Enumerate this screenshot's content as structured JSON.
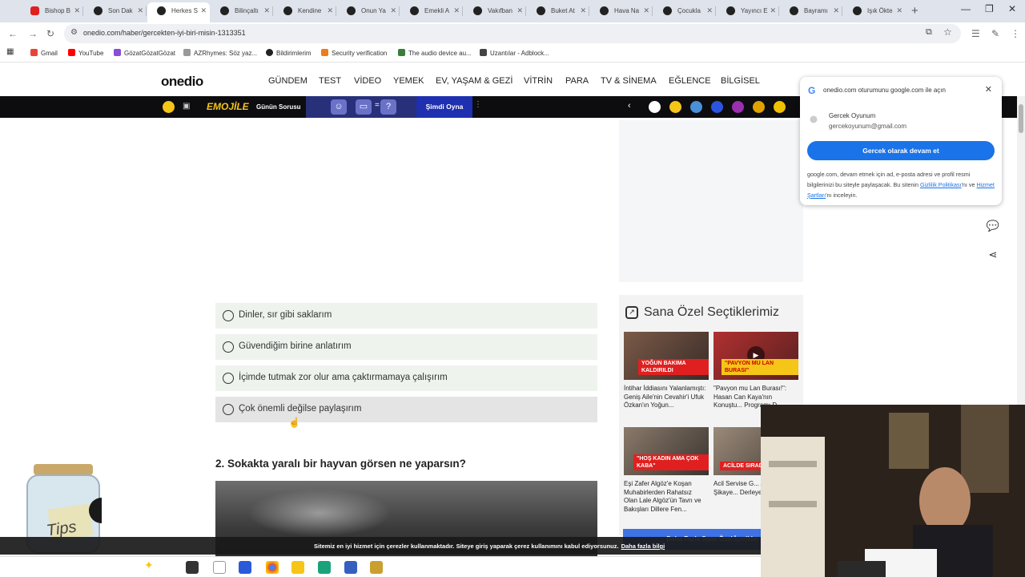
{
  "browser": {
    "tabs": [
      {
        "label": "Bishop B",
        "icon": "youtube-icon",
        "active": false
      },
      {
        "label": "Son Dak",
        "icon": "onedio-icon",
        "active": false
      },
      {
        "label": "Herkes S",
        "icon": "onedio-icon",
        "active": true
      },
      {
        "label": "Bilinçaltı",
        "icon": "onedio-icon",
        "active": false
      },
      {
        "label": "Kendine",
        "icon": "onedio-icon",
        "active": false
      },
      {
        "label": "Onun Ya",
        "icon": "onedio-icon",
        "active": false
      },
      {
        "label": "Emekli A",
        "icon": "onedio-icon",
        "active": false
      },
      {
        "label": "Vakıfban",
        "icon": "onedio-icon",
        "active": false
      },
      {
        "label": "Buket At",
        "icon": "onedio-icon",
        "active": false
      },
      {
        "label": "Hava Na",
        "icon": "onedio-icon",
        "active": false
      },
      {
        "label": "Çocukla",
        "icon": "onedio-icon",
        "active": false
      },
      {
        "label": "Yayıncı E",
        "icon": "onedio-icon",
        "active": false
      },
      {
        "label": "Bayramı",
        "icon": "onedio-icon",
        "active": false
      },
      {
        "label": "Işık Ökte",
        "icon": "onedio-icon",
        "active": false
      }
    ],
    "url": "onedio.com/haber/gercekten-iyi-biri-misin-1313351",
    "bookmarks": [
      {
        "label": "Gmail",
        "color": "#ea4335"
      },
      {
        "label": "YouTube",
        "color": "#ff0000"
      },
      {
        "label": "GözatGözatGözat",
        "color": "#8a4dd6"
      },
      {
        "label": "AZRhymes: Söz yaz...",
        "color": "#666666"
      },
      {
        "label": "Bildirimlerim",
        "color": "#222222"
      },
      {
        "label": "Security verification",
        "color": "#f07b1a"
      },
      {
        "label": "The audio device au...",
        "color": "#3a7d3a"
      },
      {
        "label": "Uzantılar - Adblock...",
        "color": "#444444"
      }
    ]
  },
  "site": {
    "logo": "onedio",
    "menu": [
      "GÜNDEM",
      "TEST",
      "VİDEO",
      "YEMEK",
      "EV, YAŞAM & GEZİ",
      "VİTRİN",
      "PARA",
      "TV & SİNEMA",
      "EĞLENCE",
      "BİLGİSEL"
    ]
  },
  "gamebar": {
    "brand": "EMOJİLE",
    "label": "Günün Sorusu",
    "equals": "=",
    "question": "?",
    "play": "Şimdi Oyna"
  },
  "quiz": {
    "options": [
      "Dinler, sır gibi saklarım",
      "Güvendiğim birine anlatırım",
      "İçimde tutmak zor olur ama çaktırmamaya çalışırım",
      "Çok önemli değilse paylaşırım"
    ],
    "question2": "2. Sokakta yaralı bir hayvan görsen ne yaparsın?"
  },
  "recommendations": {
    "title": "Sana Özel Seçtiklerimiz",
    "cards": [
      {
        "title": "İntihar İddiasını Yalanlamıştı: Geniş Aile'nin Cevahir'i Ufuk Özkan'ın Yoğun...",
        "badge": "YOĞUN BAKIMA KALDIRILDI"
      },
      {
        "title": "\"Pavyon mu Lan Burası!\": Hasan Can Kaya'nın Konuştu... Programı D...",
        "badge": "\"PAVYON MU LAN BURASI\""
      },
      {
        "title": "Eşi Zafer Algöz'e Koşan Muhabirlerden Rahatsız Olan Lale Algöz'ün Tavrı ve Bakışları Dillere Fen...",
        "badge": "\"HOŞ KADIN AMA ÇOK KABA\""
      },
      {
        "title": "Acil Servise G... Absürt Şikaye... Derleyen Dok...",
        "badge": "ACİLDE SIRADA"
      }
    ],
    "more_button": "Daha Fazla Sana Özel İçerikler"
  },
  "google_popup": {
    "header": "onedio.com oturumunu google.com ile açın",
    "name": "Gercek Oyunum",
    "email": "gercekoyunum@gmail.com",
    "continue": "Gercek olarak devam et",
    "notice_start": "google.com, devam etmek için ad, e-posta adresi ve profil resmi bilgilerinizi bu siteyle paylaşacak. Bu sitenin ",
    "privacy_link": "Gizlilik Politikası",
    "notice_mid": "'nı ve ",
    "terms_link": "Hizmet Şartları",
    "notice_end": "'nı inceleyin."
  },
  "cookie_bar": {
    "text": "Sitemiz en iyi hizmet için çerezler kullanmaktadır. Siteye giriş yaparak çerez kullanımını kabul ediyorsunuz.",
    "link": "Daha fazla bilgi"
  },
  "overlay": {
    "tip_label": "Tips"
  },
  "colors": {
    "brand_blue": "#1a73e8",
    "gamebar_bg": "#0d0d0f",
    "option_bg": "#eef3ee"
  }
}
